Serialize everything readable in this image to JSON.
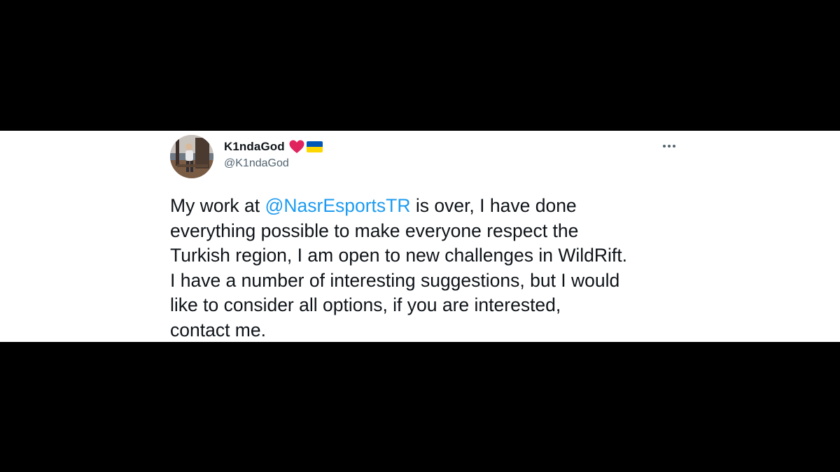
{
  "tweet": {
    "author": {
      "display_name": "K1ndaGod",
      "handle": "@K1ndaGod",
      "avatar_icon": "profile-photo",
      "badges": [
        {
          "name": "red-heart-icon",
          "color": "#e0245e"
        },
        {
          "name": "ukraine-flag-icon",
          "colors": [
            "#0057b7",
            "#ffd700"
          ]
        }
      ]
    },
    "more_icon": "more-options-icon",
    "text_before_mention": "My work at ",
    "mention": "@NasrEsportsTR",
    "text_after_mention": "  is over, I have done\neverything possible to make everyone respect the\nTurkish region, I am open to new challenges in WildRift.\nI have a number of interesting suggestions, but I would\nlike to consider all options, if you are interested,\ncontact me."
  },
  "colors": {
    "background_letterbox": "#000000",
    "card_background": "#ffffff",
    "text_primary": "#0f1419",
    "text_secondary": "#536471",
    "link": "#1d9bf0"
  }
}
